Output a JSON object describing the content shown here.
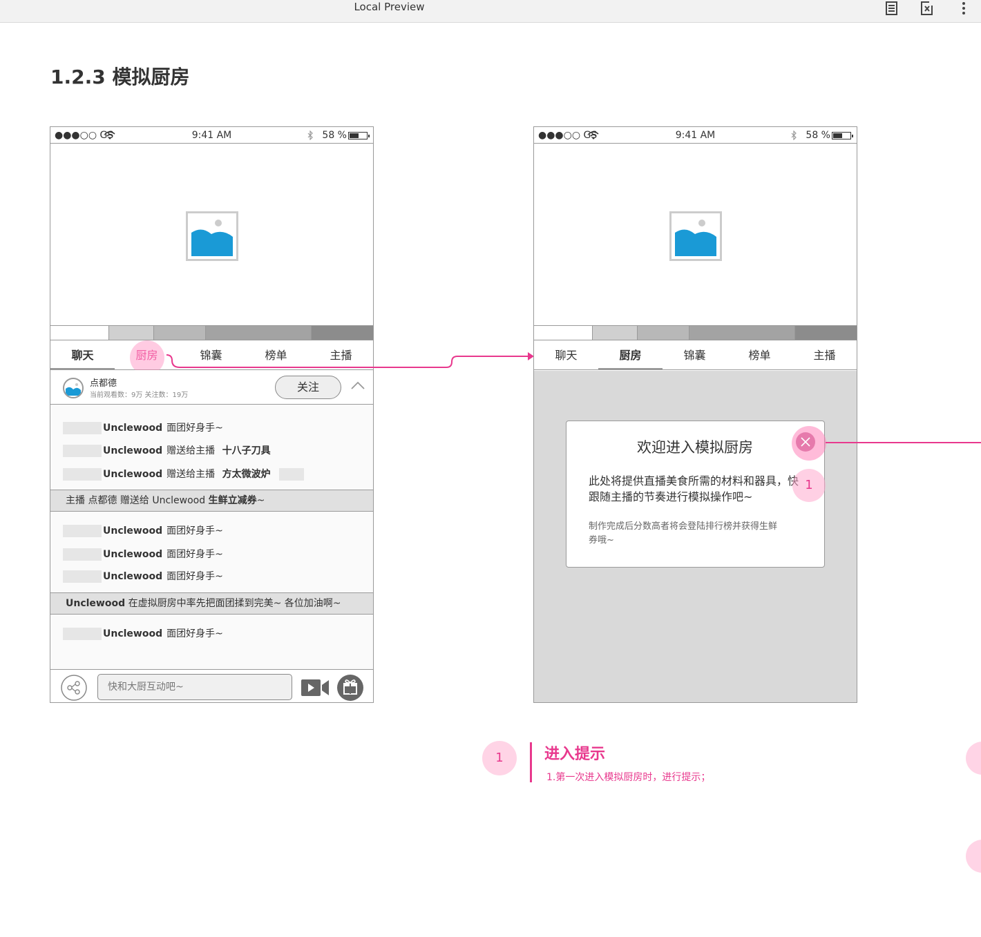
{
  "window": {
    "title": "Local Preview"
  },
  "page": {
    "section_title": "1.2.3 模拟厨房"
  },
  "status_bar": {
    "carrier": "●●●○○ GS",
    "time": "9:41 AM",
    "battery": "58 %"
  },
  "tabs": [
    "聊天",
    "厨房",
    "锦囊",
    "榜单",
    "主播"
  ],
  "anchor": {
    "name": "点都德",
    "stats": "当前观看数：9万  关注数：19万",
    "follow_label": "关注"
  },
  "chat": [
    {
      "user": "Unclewood",
      "text": "面团好身手~"
    },
    {
      "user": "Unclewood",
      "text": "赠送给主播",
      "item": "十八子刀具"
    },
    {
      "user": "Unclewood",
      "text": "赠送给主播",
      "item": "方太微波炉"
    },
    {
      "user": "Unclewood",
      "text": "面团好身手~"
    },
    {
      "user": "Unclewood",
      "text": "面团好身手~"
    },
    {
      "user": "Unclewood",
      "text": "面团好身手~"
    },
    {
      "user": "Unclewood",
      "text": "面团好身手~"
    }
  ],
  "system_messages": {
    "gift_prefix": "主播 点都德  赠送给 Unclewood ",
    "gift_item": "生鲜立减券",
    "gift_suffix": "~",
    "notice_user": "Unclewood",
    "notice_text": " 在虚拟厨房中率先把面团揉到完美~ 各位加油啊~"
  },
  "input": {
    "placeholder": "快和大厨互动吧~"
  },
  "dialog": {
    "title": "欢迎进入模拟厨房",
    "body": "此处将提供直播美食所需的材料和器具，快跟随主播的节奏进行模拟操作吧~",
    "footer": "制作完成后分数高者将会登陆排行榜并获得生鲜券哦~"
  },
  "annotation": {
    "marker": "1",
    "title": "进入提示",
    "text": "1.第一次进入模拟厨房时，进行提示；"
  },
  "colors": {
    "accent": "#e8388d",
    "image_blue": "#1a9ad6"
  }
}
